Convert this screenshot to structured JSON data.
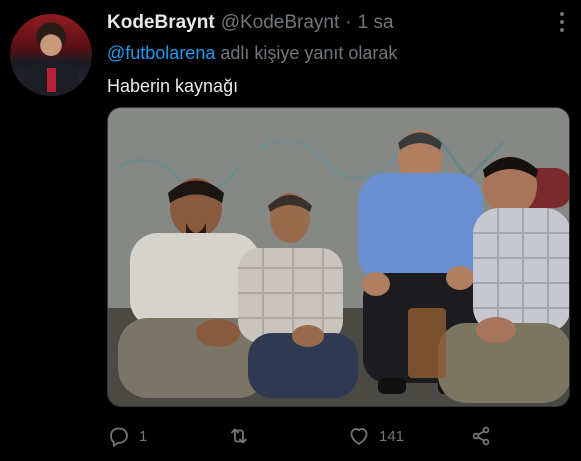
{
  "tweet": {
    "author_name": "KodeBraynt",
    "author_handle": "@KodeBraynt",
    "separator": "·",
    "time": "1 sa",
    "reply_mention": "@futbolarena",
    "reply_suffix": " adlı kişiye yanıt olarak",
    "text": "Haberin kaynağı"
  },
  "actions": {
    "reply_count": "1",
    "retweet_count": "",
    "like_count": "141"
  },
  "icons": {
    "reply": "reply-icon",
    "retweet": "retweet-icon",
    "like": "heart-icon",
    "share": "share-icon",
    "more": "more-icon"
  },
  "colors": {
    "background": "#000000",
    "text_primary": "#e7e9ea",
    "text_secondary": "#71767b",
    "accent": "#1d9bf0"
  }
}
